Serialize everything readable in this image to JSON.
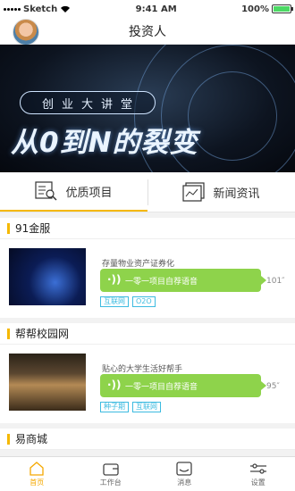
{
  "status": {
    "carrier": "Sketch",
    "time": "9:41 AM",
    "battery": "100%",
    "battery_level": 1.0
  },
  "nav": {
    "title": "投资人"
  },
  "banner": {
    "subtitle": "创业大讲堂",
    "headline": "从0到N的裂变"
  },
  "tabs": [
    {
      "label": "优质项目",
      "icon": "project-list-icon",
      "active": true
    },
    {
      "label": "新闻资讯",
      "icon": "news-icon",
      "active": false
    }
  ],
  "projects": [
    {
      "name": "91金服",
      "description": "存量物业资产证券化",
      "pitch": "一零一项目自荐语音",
      "duration": "101″",
      "tags": [
        "互联网",
        "O2O"
      ]
    },
    {
      "name": "帮帮校园网",
      "description": "贴心的大学生活好帮手",
      "pitch": "一零一项目自荐语音",
      "duration": "95″",
      "tags": [
        "种子期",
        "互联网"
      ]
    },
    {
      "name": "易商城"
    }
  ],
  "tabbar": [
    {
      "label": "首页",
      "icon": "home-icon",
      "active": true
    },
    {
      "label": "工作台",
      "icon": "wallet-icon",
      "active": false
    },
    {
      "label": "消息",
      "icon": "message-icon",
      "active": false
    },
    {
      "label": "设置",
      "icon": "settings-icon",
      "active": false
    }
  ],
  "colors": {
    "accent": "#f5b800",
    "pitch_green": "#8ed34b",
    "tag_blue": "#3dbbe0"
  }
}
